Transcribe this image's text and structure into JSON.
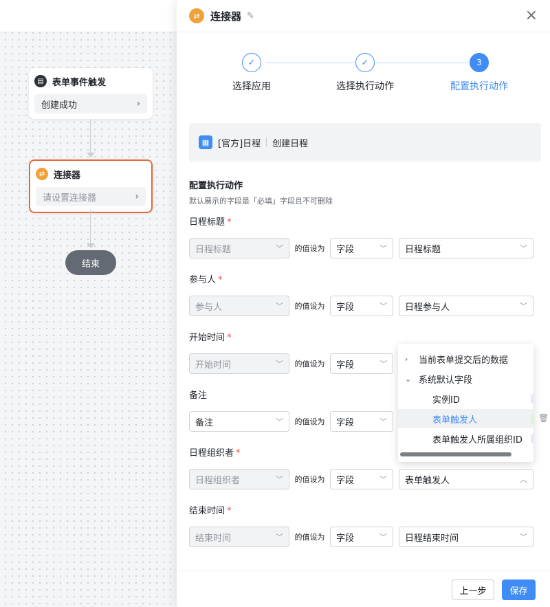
{
  "canvas": {
    "trigger": {
      "title": "表单事件触发",
      "body": "创建成功"
    },
    "connector": {
      "title": "连接器",
      "body": "请设置连接器"
    },
    "end": "结束"
  },
  "drawer": {
    "title": "连接器",
    "steps": [
      {
        "num": "✓",
        "label": "选择应用"
      },
      {
        "num": "✓",
        "label": "选择执行动作"
      },
      {
        "num": "3",
        "label": "配置执行动作"
      }
    ],
    "app": {
      "name": "[官方]日程",
      "action": "创建日程"
    },
    "section_title": "配置执行动作",
    "section_desc": "默认展示的字段是「必填」字段且不可删除",
    "set_to": "的值设为",
    "fields": [
      {
        "label": "日程标题",
        "required": "*",
        "target": "日程标题",
        "type": "字段",
        "value": "日程标题"
      },
      {
        "label": "参与人",
        "required": "*",
        "target": "参与人",
        "type": "字段",
        "value": "日程参与人"
      },
      {
        "label": "开始时间",
        "required": "*",
        "target": "开始时间",
        "type": "字段",
        "value": ""
      },
      {
        "label": "备注",
        "required": "",
        "target": "备注",
        "type": "字段",
        "value": ""
      },
      {
        "label": "日程组织者",
        "required": "*",
        "target": "日程组织者",
        "type": "字段",
        "value": "表单触发人"
      },
      {
        "label": "结束时间",
        "required": "*",
        "target": "结束时间",
        "type": "字段",
        "value": "日程结束时间"
      }
    ],
    "dropdown": {
      "groups": [
        {
          "label": "当前表单提交后的数据",
          "expanded": false
        },
        {
          "label": "系统默认字段",
          "expanded": true
        }
      ],
      "items": [
        "实例ID",
        "表单触发人",
        "表单触发人所属组织ID"
      ],
      "selected": "表单触发人"
    },
    "buttons": {
      "prev": "上一步",
      "save": "保存"
    }
  }
}
